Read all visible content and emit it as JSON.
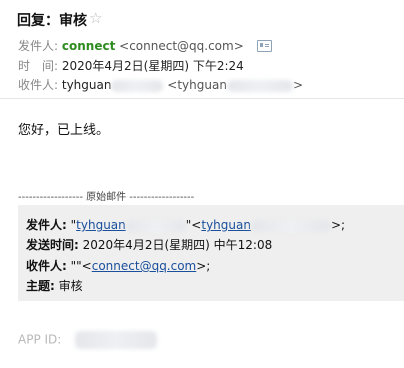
{
  "header": {
    "subject": "回复：审核",
    "star_glyph": "☆",
    "from": {
      "label": "发件人:",
      "name": "connect",
      "email": "<connect@qq.com>",
      "icon": "contact-card-icon"
    },
    "time": {
      "label": "时　间:",
      "value": "2020年4月2日(星期四) 下午2:24"
    },
    "to": {
      "label": "收件人:",
      "name": "tyhguan",
      "email_prefix": "<tyhguan",
      "email_suffix": ">"
    }
  },
  "body": {
    "text": "您好，已上线。"
  },
  "original": {
    "separator": "------------------ 原始邮件 ------------------",
    "from_label": "发件人:",
    "from_quote_open": "\"",
    "from_name": "tyhguan",
    "from_quote_close": "\"",
    "from_email_open": "<",
    "from_email": "tyhguan",
    "from_email_close": ">;",
    "time_label": "发送时间:",
    "time_value": "2020年4月2日(星期四) 中午12:08",
    "to_label": "收件人:",
    "to_prefix": "\"\"<",
    "to_email": "connect@qq.com",
    "to_suffix": ">;",
    "subject_label": "主题:",
    "subject_value": "审核"
  },
  "footer": {
    "app_id_label": "APP ID:"
  }
}
